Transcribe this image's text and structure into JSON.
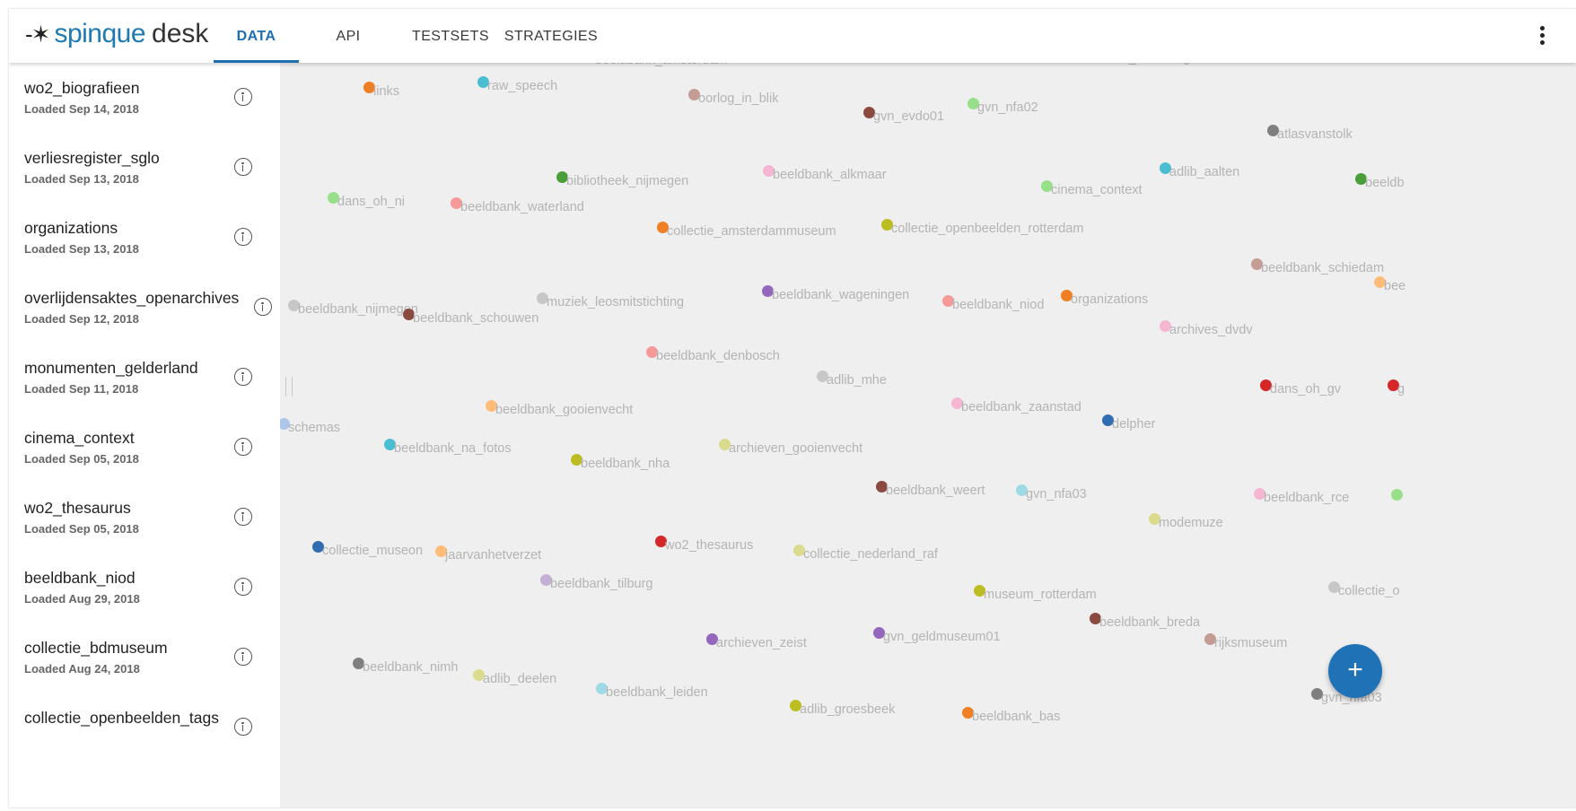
{
  "header": {
    "logo_mark": "-✶",
    "logo_spinque": "spinque",
    "logo_desk": "desk",
    "tabs": [
      {
        "label": "DATA"
      },
      {
        "label": "API"
      },
      {
        "label": "TESTSETS"
      },
      {
        "label": "STRATEGIES"
      }
    ],
    "active_tab": "DATA"
  },
  "sidebar": {
    "items": [
      {
        "name": "wo2_biografieen",
        "date": "Loaded Sep 14, 2018"
      },
      {
        "name": "verliesregister_sglo",
        "date": "Loaded Sep 13, 2018"
      },
      {
        "name": "organizations",
        "date": "Loaded Sep 13, 2018"
      },
      {
        "name": "overlijdensaktes_openarchives",
        "date": "Loaded Sep 12, 2018"
      },
      {
        "name": "monumenten_gelderland",
        "date": "Loaded Sep 11, 2018"
      },
      {
        "name": "cinema_context",
        "date": "Loaded Sep 05, 2018"
      },
      {
        "name": "wo2_thesaurus",
        "date": "Loaded Sep 05, 2018"
      },
      {
        "name": "beeldbank_niod",
        "date": "Loaded Aug 29, 2018"
      },
      {
        "name": "collectie_bdmuseum",
        "date": "Loaded Aug 24, 2018"
      },
      {
        "name": "collectie_openbeelden_tags",
        "date": ""
      }
    ]
  },
  "graph": {
    "nodes": [
      {
        "label": "links",
        "color": "#ef7f22"
      },
      {
        "label": "raw_speech",
        "color": "#4bbdd1"
      },
      {
        "label": "oorlog_in_blik",
        "color": "#c49c94"
      },
      {
        "label": "gvn_evdo01",
        "color": "#8b4a40"
      },
      {
        "label": "gvn_nfa02",
        "color": "#98df8a"
      },
      {
        "label": "atlasvanstolk",
        "color": "#7f7f7f"
      },
      {
        "label": "bibliotheek_nijmegen",
        "color": "#4a9e3a"
      },
      {
        "label": "beeldbank_alkmaar",
        "color": "#f5b6d2"
      },
      {
        "label": "adlib_aalten",
        "color": "#4bbdd1"
      },
      {
        "label": "beeldb",
        "color": "#4a9e3a"
      },
      {
        "label": "dans_oh_ni",
        "color": "#98df8a"
      },
      {
        "label": "beeldbank_waterland",
        "color": "#f59999"
      },
      {
        "label": "cinema_context",
        "color": "#98df8a"
      },
      {
        "label": "collectie_amsterdammuseum",
        "color": "#ef7f22"
      },
      {
        "label": "collectie_openbeelden_rotterdam",
        "color": "#bcbd22"
      },
      {
        "label": "beeldbank_schiedam",
        "color": "#c49c94"
      },
      {
        "label": "bee",
        "color": "#ffbb78"
      },
      {
        "label": "beeldbank_nijmegen",
        "color": "#c7c7c7"
      },
      {
        "label": "beeldbank_schouwen",
        "color": "#8b4a40"
      },
      {
        "label": "muziek_leosmitstichting",
        "color": "#c7c7c7"
      },
      {
        "label": "beeldbank_wageningen",
        "color": "#9467bd"
      },
      {
        "label": "beeldbank_niod",
        "color": "#f59999"
      },
      {
        "label": "organizations",
        "color": "#ef7f22"
      },
      {
        "label": "archives_dvdv",
        "color": "#f5b6d2"
      },
      {
        "label": "beeldbank_denbosch",
        "color": "#f59999"
      },
      {
        "label": "adlib_mhe",
        "color": "#c7c7c7"
      },
      {
        "label": "dans_oh_gv",
        "color": "#d62728"
      },
      {
        "label": "g",
        "color": "#d62728"
      },
      {
        "label": "schemas",
        "color": "#aec7e8"
      },
      {
        "label": "beeldbank_gooienvecht",
        "color": "#ffbb78"
      },
      {
        "label": "beeldbank_zaanstad",
        "color": "#f5b6d2"
      },
      {
        "label": "delpher",
        "color": "#2f6db0"
      },
      {
        "label": "beeldbank_na_fotos",
        "color": "#4bbdd1"
      },
      {
        "label": "archieven_gooienvecht",
        "color": "#dbdb8d"
      },
      {
        "label": "beeldbank_nha",
        "color": "#bcbd22"
      },
      {
        "label": "beeldbank_weert",
        "color": "#8b4a40"
      },
      {
        "label": "gvn_nfa03",
        "color": "#9edae5"
      },
      {
        "label": "beeldbank_rce",
        "color": "#f5b6d2"
      },
      {
        "label": "",
        "color": "#98df8a"
      },
      {
        "label": "modemuze",
        "color": "#dbdb8d"
      },
      {
        "label": "collectie_museon",
        "color": "#2f6db0"
      },
      {
        "label": "jaarvanhetverzet",
        "color": "#ffbb78"
      },
      {
        "label": "wo2_thesaurus",
        "color": "#d62728"
      },
      {
        "label": "collectie_nederland_raf",
        "color": "#dbdb8d"
      },
      {
        "label": "beeldbank_tilburg",
        "color": "#c5b0d5"
      },
      {
        "label": "museum_rotterdam",
        "color": "#bcbd22"
      },
      {
        "label": "collectie_o",
        "color": "#c7c7c7"
      },
      {
        "label": "beeldbank_breda",
        "color": "#8b4a40"
      },
      {
        "label": "archieven_zeist",
        "color": "#9467bd"
      },
      {
        "label": "gvn_geldmuseum01",
        "color": "#9467bd"
      },
      {
        "label": "rijksmuseum",
        "color": "#c49c94"
      },
      {
        "label": "beeldbank_nimh",
        "color": "#7f7f7f"
      },
      {
        "label": "adlib_deelen",
        "color": "#dbdb8d"
      },
      {
        "label": "beeldbank_leiden",
        "color": "#9edae5"
      },
      {
        "label": "gvn_nfa03",
        "color": "#7f7f7f"
      },
      {
        "label": "adlib_groesbeek",
        "color": "#bcbd22"
      },
      {
        "label": "beeldbank_bas",
        "color": "#ef7f22"
      },
      {
        "label": "beeldbank_heimburg",
        "color": "#aec7e8"
      },
      {
        "label": "beeldbank_amsterdam",
        "color": "#c7c7c7"
      }
    ]
  },
  "fab": {
    "label": "+"
  }
}
